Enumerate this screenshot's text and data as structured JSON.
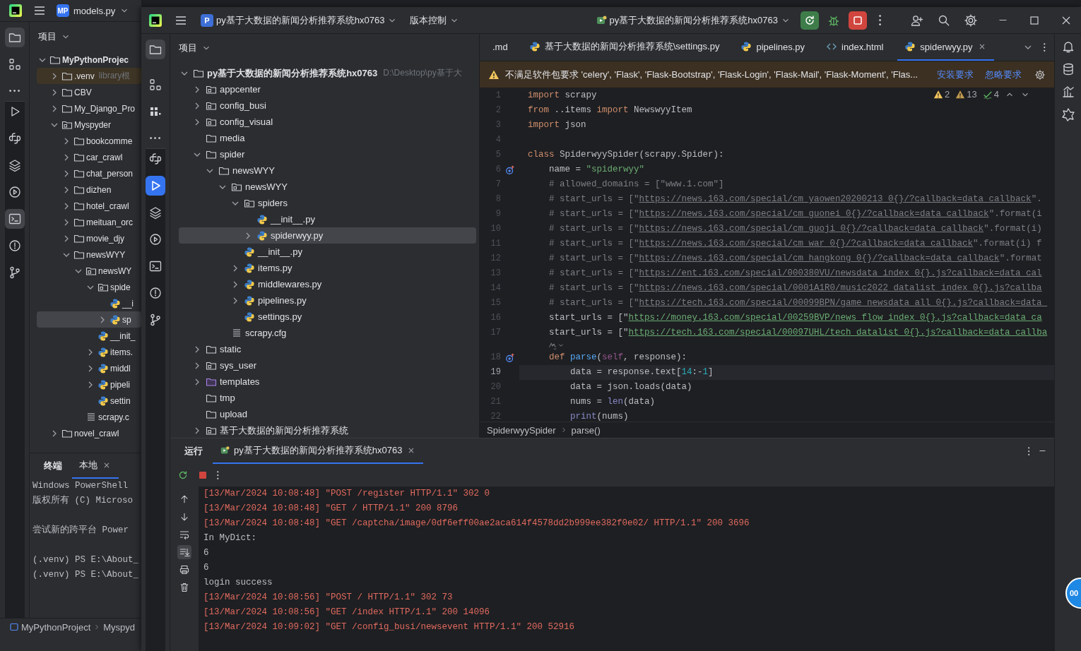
{
  "background_window": {
    "title_tab": {
      "badge": "MP",
      "label": "models.py"
    },
    "project_panel": {
      "title": "项目",
      "tree": [
        {
          "label": "MyPythonProjec",
          "kind": "root",
          "expanded": true,
          "selected": false,
          "children": [
            {
              "label": ".venv",
              "kind": "excluded",
              "hint": "library根",
              "expanded": false,
              "selected": false
            },
            {
              "label": "CBV",
              "kind": "folder",
              "expanded": false,
              "selected": false
            },
            {
              "label": "My_Django_Pro",
              "kind": "folder",
              "expanded": false,
              "selected": false
            },
            {
              "label": "Myspyder",
              "kind": "package",
              "expanded": true,
              "selected": false,
              "children": [
                {
                  "label": "bookcomme",
                  "kind": "folder",
                  "expanded": false,
                  "selected": false
                },
                {
                  "label": "car_crawl",
                  "kind": "folder",
                  "expanded": false,
                  "selected": false
                },
                {
                  "label": "chat_person",
                  "kind": "folder",
                  "expanded": false,
                  "selected": false
                },
                {
                  "label": "dizhen",
                  "kind": "folder",
                  "expanded": false,
                  "selected": false
                },
                {
                  "label": "hotel_crawl",
                  "kind": "folder",
                  "expanded": false,
                  "selected": false
                },
                {
                  "label": "meituan_orc",
                  "kind": "folder",
                  "expanded": false,
                  "selected": false
                },
                {
                  "label": "movie_djy",
                  "kind": "folder",
                  "expanded": false,
                  "selected": false
                },
                {
                  "label": "newsWYY",
                  "kind": "folder",
                  "expanded": true,
                  "selected": false,
                  "children": [
                    {
                      "label": "newsWY",
                      "kind": "package",
                      "expanded": true,
                      "selected": false,
                      "children": [
                        {
                          "label": "spide",
                          "kind": "package",
                          "expanded": true,
                          "selected": false,
                          "children": [
                            {
                              "label": "__i",
                              "kind": "python",
                              "selected": false
                            },
                            {
                              "label": "sp",
                              "kind": "python",
                              "expanded": false,
                              "selected": true
                            }
                          ]
                        },
                        {
                          "label": "__init_",
                          "kind": "python",
                          "selected": false
                        },
                        {
                          "label": "items.",
                          "kind": "python",
                          "expanded": false,
                          "selected": false
                        },
                        {
                          "label": "middl",
                          "kind": "python",
                          "expanded": false,
                          "selected": false
                        },
                        {
                          "label": "pipeli",
                          "kind": "python",
                          "expanded": false,
                          "selected": false
                        },
                        {
                          "label": "settin",
                          "kind": "python",
                          "selected": false
                        }
                      ]
                    },
                    {
                      "label": "scrapy.c",
                      "kind": "text",
                      "selected": false
                    }
                  ]
                }
              ]
            },
            {
              "label": "novel_crawl",
              "kind": "folder",
              "expanded": false,
              "selected": false
            }
          ]
        }
      ]
    },
    "terminal": {
      "title": "终端",
      "tabs": [
        {
          "label": "本地",
          "selected": true
        }
      ],
      "lines": [
        {
          "kind": "text",
          "text": "Windows PowerShell"
        },
        {
          "kind": "text",
          "text": "版权所有 (C) Microso"
        },
        {
          "kind": "blank"
        },
        {
          "kind": "text",
          "text": "尝试新的跨平台 Power"
        },
        {
          "kind": "blank"
        },
        {
          "kind": "text",
          "text": "(.venv) PS E:\\About_"
        },
        {
          "kind": "text",
          "text": "(.venv) PS E:\\About_"
        }
      ]
    },
    "breadcrumb": [
      "MyPythonProject",
      "Myspyd"
    ]
  },
  "main_window": {
    "project": {
      "badge": "P",
      "name": "py基于大数据的新闻分析推荐系统hx0763"
    },
    "vcs_menu": "版本控制",
    "run_config": "py基于大数据的新闻分析推荐系统hx0763",
    "project_panel": {
      "title": "项目",
      "tree": [
        {
          "label": "py基于大数据的新闻分析推荐系统hx0763",
          "kind": "root",
          "hint": "D:\\Desktop\\py基于大",
          "expanded": true,
          "selected": false,
          "children": [
            {
              "label": "appcenter",
              "kind": "package",
              "expanded": false,
              "selected": false
            },
            {
              "label": "config_busi",
              "kind": "package",
              "expanded": false,
              "selected": false
            },
            {
              "label": "config_visual",
              "kind": "package",
              "expanded": false,
              "selected": false
            },
            {
              "label": "media",
              "kind": "folder",
              "selected": false
            },
            {
              "label": "spider",
              "kind": "folder",
              "expanded": true,
              "selected": false,
              "children": [
                {
                  "label": "newsWYY",
                  "kind": "folder",
                  "expanded": true,
                  "selected": false,
                  "children": [
                    {
                      "label": "newsWYY",
                      "kind": "package",
                      "expanded": true,
                      "selected": false,
                      "children": [
                        {
                          "label": "spiders",
                          "kind": "package",
                          "expanded": true,
                          "selected": false,
                          "children": [
                            {
                              "label": "__init__.py",
                              "kind": "python",
                              "selected": false
                            },
                            {
                              "label": "spiderwyy.py",
                              "kind": "python",
                              "expanded": false,
                              "selected": true
                            }
                          ]
                        },
                        {
                          "label": "__init__.py",
                          "kind": "python",
                          "selected": false
                        },
                        {
                          "label": "items.py",
                          "kind": "python",
                          "expanded": false,
                          "selected": false
                        },
                        {
                          "label": "middlewares.py",
                          "kind": "python",
                          "expanded": false,
                          "selected": false
                        },
                        {
                          "label": "pipelines.py",
                          "kind": "python",
                          "expanded": false,
                          "selected": false
                        },
                        {
                          "label": "settings.py",
                          "kind": "python",
                          "selected": false
                        }
                      ]
                    },
                    {
                      "label": "scrapy.cfg",
                      "kind": "text",
                      "selected": false
                    }
                  ]
                }
              ]
            },
            {
              "label": "static",
              "kind": "folder",
              "expanded": false,
              "selected": false
            },
            {
              "label": "sys_user",
              "kind": "package",
              "expanded": false,
              "selected": false
            },
            {
              "label": "templates",
              "kind": "templates",
              "expanded": false,
              "selected": false
            },
            {
              "label": "tmp",
              "kind": "folder",
              "selected": false
            },
            {
              "label": "upload",
              "kind": "folder",
              "selected": false
            },
            {
              "label": "基于大数据的新闻分析推荐系统",
              "kind": "package",
              "expanded": false,
              "selected": false
            }
          ]
        }
      ]
    },
    "editor": {
      "tabs": [
        {
          "label": ".md",
          "kind": "md",
          "selected": false
        },
        {
          "label": "基于大数据的新闻分析推荐系统\\settings.py",
          "kind": "python",
          "selected": false
        },
        {
          "label": "pipelines.py",
          "kind": "python",
          "selected": false
        },
        {
          "label": "index.html",
          "kind": "html",
          "selected": false
        },
        {
          "label": "spiderwyy.py",
          "kind": "python",
          "selected": true
        }
      ],
      "banner": {
        "message": "不满足软件包要求 'celery', 'Flask', 'Flask-Bootstrap', 'Flask-Login', 'Flask-Mail', 'Flask-Moment', 'Flas...",
        "actions": [
          "安装要求",
          "忽略要求"
        ]
      },
      "inspections": [
        {
          "kind": "warning",
          "count": "2"
        },
        {
          "kind": "weak_warning",
          "count": "13"
        },
        {
          "kind": "typo",
          "count": "4"
        }
      ],
      "lines": [
        {
          "kind": "code",
          "number": "1",
          "current": false,
          "tokens": [
            {
              "kind": "kw",
              "text": "import"
            },
            {
              "kind": "p",
              "text": " scrapy"
            }
          ]
        },
        {
          "kind": "code",
          "number": "2",
          "current": false,
          "tokens": [
            {
              "kind": "kw",
              "text": "from"
            },
            {
              "kind": "p",
              "text": " ..items "
            },
            {
              "kind": "kw",
              "text": "import"
            },
            {
              "kind": "p",
              "text": " NewswyyItem"
            }
          ]
        },
        {
          "kind": "code",
          "number": "3",
          "current": false,
          "tokens": [
            {
              "kind": "kw",
              "text": "import"
            },
            {
              "kind": "p",
              "text": " json"
            }
          ]
        },
        {
          "kind": "code",
          "number": "4",
          "current": false
        },
        {
          "kind": "code",
          "number": "5",
          "current": false,
          "tokens": [
            {
              "kind": "kw",
              "text": "class"
            },
            {
              "kind": "p",
              "text": " SpiderwyySpider(scrapy.Spider):"
            }
          ]
        },
        {
          "kind": "code",
          "number": "6",
          "current": false,
          "gutter": {
            "kind": "override"
          },
          "tokens": [
            {
              "kind": "p",
              "text": "    name = "
            },
            {
              "kind": "str",
              "text": "\"spiderwyy\""
            }
          ]
        },
        {
          "kind": "code",
          "number": "7",
          "current": false,
          "tokens": [
            {
              "kind": "com",
              "text": "    # allowed_domains = [\"www.1.com\"]"
            }
          ]
        },
        {
          "kind": "code",
          "number": "8",
          "current": false,
          "tokens": [
            {
              "kind": "com",
              "text": "    # start_urls = [\""
            },
            {
              "kind": "curl",
              "text": "https://news.163.com/special/cm_yaowen20200213_0{}/?callback=data_callback"
            },
            {
              "kind": "com",
              "text": "\"."
            }
          ]
        },
        {
          "kind": "code",
          "number": "9",
          "current": false,
          "tokens": [
            {
              "kind": "com",
              "text": "    # start_urls = [\""
            },
            {
              "kind": "curl",
              "text": "https://news.163.com/special/cm_guonei_0{}/?callback=data_callback"
            },
            {
              "kind": "com",
              "text": "\".format(i"
            }
          ]
        },
        {
          "kind": "code",
          "number": "10",
          "current": false,
          "tokens": [
            {
              "kind": "com",
              "text": "    # start_urls = [\""
            },
            {
              "kind": "curl",
              "text": "https://news.163.com/special/cm_guoji_0{}/?callback=data_callback"
            },
            {
              "kind": "com",
              "text": "\".format(i)"
            }
          ]
        },
        {
          "kind": "code",
          "number": "11",
          "current": false,
          "tokens": [
            {
              "kind": "com",
              "text": "    # start_urls = [\""
            },
            {
              "kind": "curl",
              "text": "https://news.163.com/special/cm_war_0{}/?callback=data_callback"
            },
            {
              "kind": "com",
              "text": "\".format(i) f"
            }
          ]
        },
        {
          "kind": "code",
          "number": "12",
          "current": false,
          "tokens": [
            {
              "kind": "com",
              "text": "    # start_urls = [\""
            },
            {
              "kind": "curl",
              "text": "https://news.163.com/special/cm_hangkong_0{}/?callback=data_callback"
            },
            {
              "kind": "com",
              "text": "\".format"
            }
          ]
        },
        {
          "kind": "code",
          "number": "13",
          "current": false,
          "tokens": [
            {
              "kind": "com",
              "text": "    # start_urls = [\""
            },
            {
              "kind": "curl",
              "text": "https://ent.163.com/special/000380VU/newsdata_index_0{}.js?callback=data_cal"
            }
          ]
        },
        {
          "kind": "code",
          "number": "14",
          "current": false,
          "tokens": [
            {
              "kind": "com",
              "text": "    # start_urls = [\""
            },
            {
              "kind": "curl",
              "text": "https://news.163.com/special/0001A1R0/music2022_datalist_index_0{}.js?callba"
            }
          ]
        },
        {
          "kind": "code",
          "number": "15",
          "current": false,
          "tokens": [
            {
              "kind": "com",
              "text": "    # start_urls = [\""
            },
            {
              "kind": "curl",
              "text": "https://tech.163.com/special/00099BPN/game_newsdata_all_0{}.js?callback=data_"
            }
          ]
        },
        {
          "kind": "code",
          "number": "16",
          "current": false,
          "tokens": [
            {
              "kind": "p",
              "text": "    start_urls = [\""
            },
            {
              "kind": "url",
              "text": "https://money.163.com/special/00259BVP/news_flow_index_0{}.js?callback=data_ca"
            }
          ]
        },
        {
          "kind": "code",
          "number": "17",
          "current": false,
          "tokens": [
            {
              "kind": "p",
              "text": "    start_urls = [\""
            },
            {
              "kind": "url",
              "text": "https://tech.163.com/special/00097UHL/tech_datalist_0{}.js?callback=data_callba"
            }
          ]
        },
        {
          "kind": "hint"
        },
        {
          "kind": "code",
          "number": "18",
          "current": false,
          "gutter": {
            "kind": "override"
          },
          "tokens": [
            {
              "kind": "kw",
              "text": "    def"
            },
            {
              "kind": "fn",
              "text": " parse"
            },
            {
              "kind": "p",
              "text": "("
            },
            {
              "kind": "self",
              "text": "self"
            },
            {
              "kind": "p",
              "text": ", response):"
            }
          ]
        },
        {
          "kind": "code",
          "number": "19",
          "current": true,
          "tokens": [
            {
              "kind": "p",
              "text": "        data = response.text["
            },
            {
              "kind": "num",
              "text": "14"
            },
            {
              "kind": "p",
              "text": ":-"
            },
            {
              "kind": "num",
              "text": "1"
            },
            {
              "kind": "p",
              "text": "]"
            }
          ]
        },
        {
          "kind": "code",
          "number": "20",
          "current": false,
          "tokens": [
            {
              "kind": "p",
              "text": "        data = json.loads(data)"
            }
          ]
        },
        {
          "kind": "code",
          "number": "21",
          "current": false,
          "tokens": [
            {
              "kind": "p",
              "text": "        nums = "
            },
            {
              "kind": "bi",
              "text": "len"
            },
            {
              "kind": "p",
              "text": "(data)"
            }
          ]
        },
        {
          "kind": "code",
          "number": "22",
          "current": false,
          "tokens": [
            {
              "kind": "bi",
              "text": "        print"
            },
            {
              "kind": "p",
              "text": "(nums)"
            }
          ]
        }
      ],
      "breadcrumb": [
        "SpiderwyySpider",
        "parse()"
      ]
    },
    "run_panel": {
      "title": "运行",
      "tabs": [
        {
          "label": "py基于大数据的新闻分析推荐系统hx0763",
          "selected": true
        }
      ],
      "lines": [
        {
          "kind": "error",
          "text": "[13/Mar/2024 10:08:48] \"POST /register HTTP/1.1\" 302 0"
        },
        {
          "kind": "error",
          "text": "[13/Mar/2024 10:08:48] \"GET / HTTP/1.1\" 200 8796"
        },
        {
          "kind": "error",
          "text": "[13/Mar/2024 10:08:48] \"GET /captcha/image/0df6eff00ae2aca614f4578dd2b999ee382f0e02/ HTTP/1.1\" 200 3696"
        },
        {
          "kind": "plain",
          "text": "In MyDict:"
        },
        {
          "kind": "plain",
          "text": "6"
        },
        {
          "kind": "plain",
          "text": "6"
        },
        {
          "kind": "plain",
          "text": "login success"
        },
        {
          "kind": "error",
          "text": "[13/Mar/2024 10:08:56] \"POST / HTTP/1.1\" 302 73"
        },
        {
          "kind": "error",
          "text": "[13/Mar/2024 10:08:56] \"GET /index HTTP/1.1\" 200 14096"
        },
        {
          "kind": "error",
          "text": "[13/Mar/2024 10:09:02] \"GET /config_busi/newsevent HTTP/1.1\" 200 52916"
        }
      ]
    }
  },
  "floating_widget": {
    "text": "00"
  }
}
